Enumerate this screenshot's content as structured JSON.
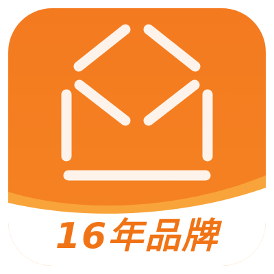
{
  "app_icon": {
    "icon": "house-icon",
    "slogan": "16年品牌",
    "colors": {
      "primary_orange": "#f47a1f",
      "light_orange": "#f8a43a",
      "band_white": "#ffffff",
      "text_orange": "#f07416"
    }
  }
}
